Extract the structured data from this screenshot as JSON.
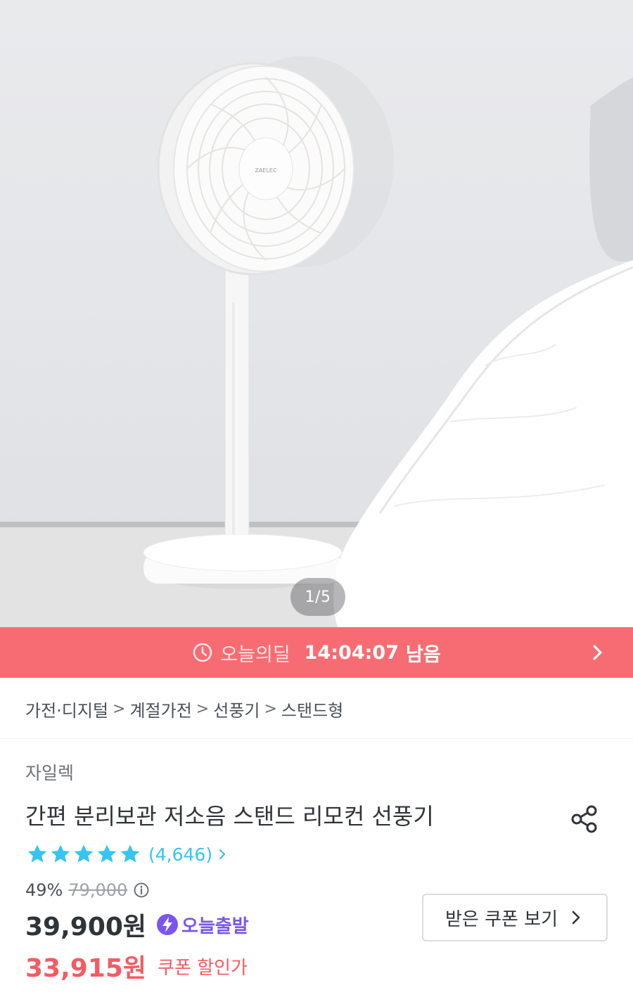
{
  "gallery": {
    "counter": "1/5",
    "fan_brand_mark": "ZAELEC"
  },
  "deal": {
    "label": "오늘의딜",
    "time": "14:04:07",
    "remain": "남음",
    "clock_icon": "clock-icon",
    "arrow_icon": "chevron-right-icon"
  },
  "breadcrumb": {
    "items": [
      "가전·디지털",
      "계절가전",
      "선풍기",
      "스탠드형"
    ],
    "separator": ">"
  },
  "product": {
    "brand": "자일렉",
    "title": "간편 분리보관 저소음 스탠드 리모컨 선풍기",
    "rating": 5,
    "review_count": "(4,646)",
    "discount_pct": "49%",
    "original_price": "79,000",
    "price": "39,900원",
    "delivery_badge": "오늘출발",
    "coupon_price": "33,915원",
    "coupon_label": "쿠폰 할인가"
  },
  "buttons": {
    "coupon": "받은 쿠폰 보기"
  },
  "colors": {
    "deal_banner": "#f76c72",
    "review_link": "#35c5f0",
    "star": "#35c5f0",
    "coupon_price": "#f45b62",
    "today_badge": "#7c55f0"
  }
}
